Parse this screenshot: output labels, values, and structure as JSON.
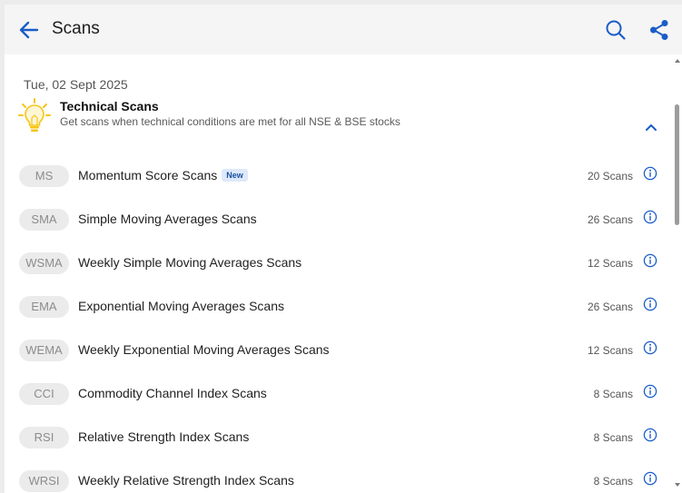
{
  "header": {
    "title": "Scans"
  },
  "content": {
    "date": "Tue, 02 Sept 2025",
    "section": {
      "title": "Technical Scans",
      "subtitle": "Get scans when technical conditions are met for all NSE & BSE stocks"
    },
    "rows": [
      {
        "badge": "MS",
        "label": "Momentum Score Scans",
        "tag": "New",
        "count": "20 Scans"
      },
      {
        "badge": "SMA",
        "label": "Simple Moving Averages Scans",
        "count": "26 Scans"
      },
      {
        "badge": "WSMA",
        "label": "Weekly Simple Moving Averages Scans",
        "count": "12 Scans"
      },
      {
        "badge": "EMA",
        "label": "Exponential Moving Averages Scans",
        "count": "26 Scans"
      },
      {
        "badge": "WEMA",
        "label": "Weekly Exponential Moving Averages Scans",
        "count": "12 Scans"
      },
      {
        "badge": "CCI",
        "label": "Commodity Channel Index Scans",
        "count": "8 Scans"
      },
      {
        "badge": "RSI",
        "label": "Relative Strength Index Scans",
        "count": "8 Scans"
      },
      {
        "badge": "WRSI",
        "label": "Weekly Relative Strength Index Scans",
        "count": "8 Scans"
      }
    ]
  },
  "icons": {
    "back": "arrow-left-icon",
    "search": "search-icon",
    "share": "share-icon",
    "bulb": "lightbulb-icon",
    "collapse": "chevron-up-icon",
    "info": "info-icon"
  },
  "colors": {
    "accent": "#1a5dc7",
    "bulb": "#f5c518",
    "badge_bg": "#ebebeb",
    "tag_bg": "#dde9fb"
  }
}
